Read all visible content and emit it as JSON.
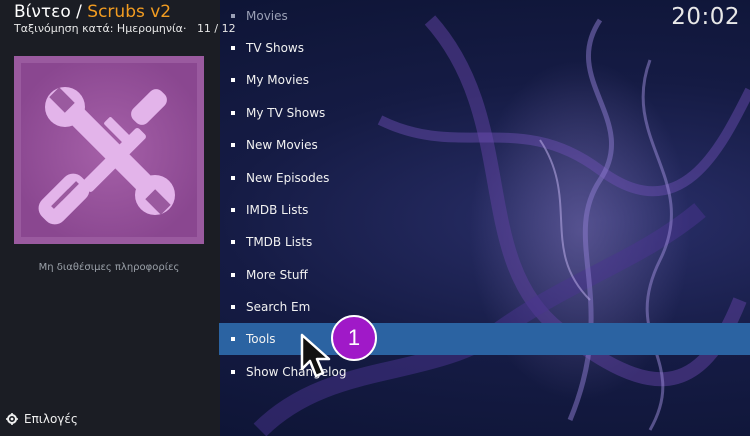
{
  "header": {
    "breadcrumb_root": "Βίντεο",
    "breadcrumb_separator": "/",
    "breadcrumb_current": "Scrubs v2",
    "sort_label": "Ταξινόμηση κατά: Ημερομηνία",
    "separator_dot": "·",
    "counter": "11 / 12",
    "clock": "20:02"
  },
  "info_panel": {
    "no_info": "Μη διαθέσιμες πληροφορίες",
    "thumbnail_icon": "tools-icon"
  },
  "footer": {
    "options_label": "Επιλογές",
    "options_icon": "gear-icon"
  },
  "menu": {
    "items": [
      {
        "label": "Movies"
      },
      {
        "label": "TV Shows"
      },
      {
        "label": "My Movies"
      },
      {
        "label": "My TV Shows"
      },
      {
        "label": "New Movies"
      },
      {
        "label": "New Episodes"
      },
      {
        "label": "IMDB Lists"
      },
      {
        "label": "TMDB Lists"
      },
      {
        "label": "More Stuff"
      },
      {
        "label": "Search Em"
      },
      {
        "label": "Tools"
      },
      {
        "label": "Show Changelog"
      }
    ],
    "selected": "Tools"
  },
  "annotation": {
    "step_number": "1"
  },
  "colors": {
    "accent": "#f29c21",
    "selection": "#2b63a2",
    "badge": "#a019c8",
    "thumbnail_bg": "#9a5a9f",
    "icon": "#e3b4ea"
  }
}
